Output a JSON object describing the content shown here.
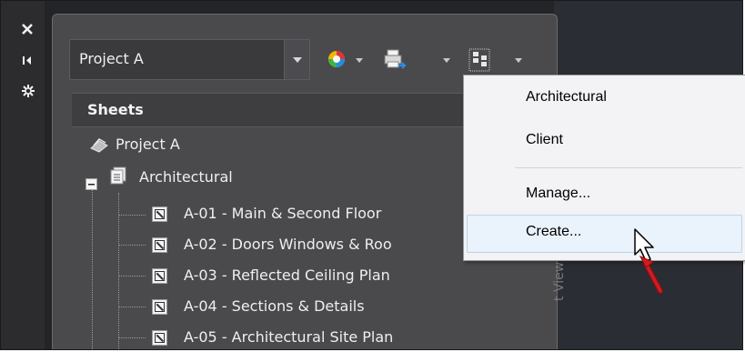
{
  "side_toolbar": {
    "close_icon": "close-icon",
    "pin_icon": "auto-hide-icon",
    "settings_icon": "settings-icon"
  },
  "project_combo": {
    "value": "Project A"
  },
  "toolbar": {
    "icons": [
      "publish-icon",
      "plot-icon",
      "sheet-set-view-icon"
    ]
  },
  "sheets_header": {
    "label": "Sheets"
  },
  "tree": {
    "root": "Project A",
    "group": "Architectural",
    "sheets": [
      "A-01 - Main & Second Floor",
      "A-02 - Doors Windows & Roo",
      "A-03 - Reflected Ceiling Plan",
      "A-04 - Sections & Details",
      "A-05 - Architectural Site Plan"
    ]
  },
  "side_tab_label": "t Views",
  "context_menu": {
    "items": [
      "Architectural",
      "Client",
      "Manage...",
      "Create..."
    ],
    "highlighted": "Create..."
  },
  "colors": {
    "panel_bg": "#4a4a4d",
    "menu_bg": "#f3f3f5",
    "highlight": "#eaf2fb",
    "arrow": "#c0161c"
  }
}
